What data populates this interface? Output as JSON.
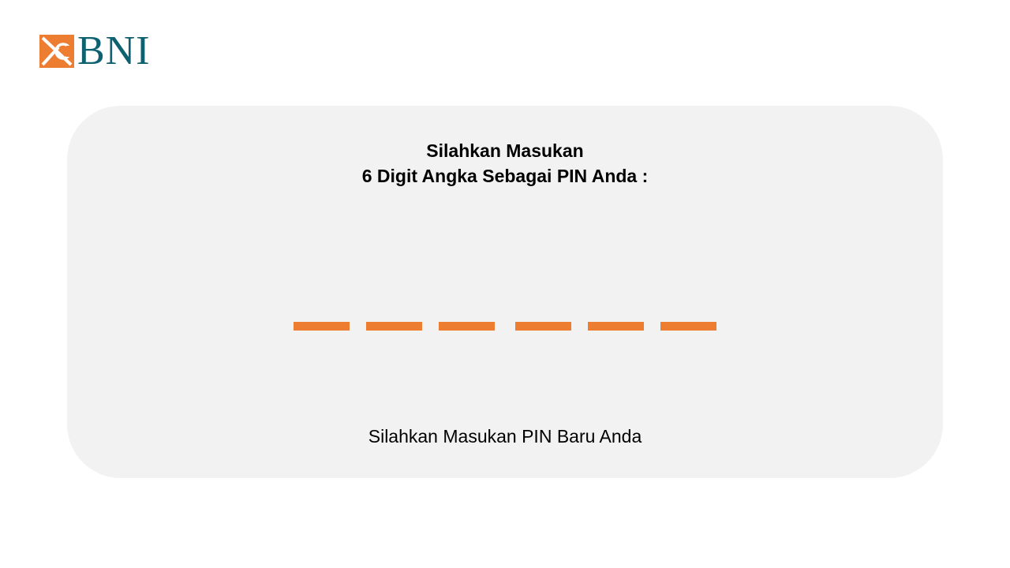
{
  "brand": {
    "logo_text": "BNI",
    "logo_color": "#0e6170",
    "accent_color": "#ed7d31"
  },
  "panel": {
    "heading_line1": "Silahkan Masukan",
    "heading_line2": "6 Digit Angka Sebagai PIN Anda :",
    "pin_slots": [
      {
        "digit": ""
      },
      {
        "digit": ""
      },
      {
        "digit": ""
      },
      {
        "digit": ""
      },
      {
        "digit": ""
      },
      {
        "digit": ""
      }
    ],
    "prompt": "Silahkan Masukan PIN Baru Anda"
  }
}
